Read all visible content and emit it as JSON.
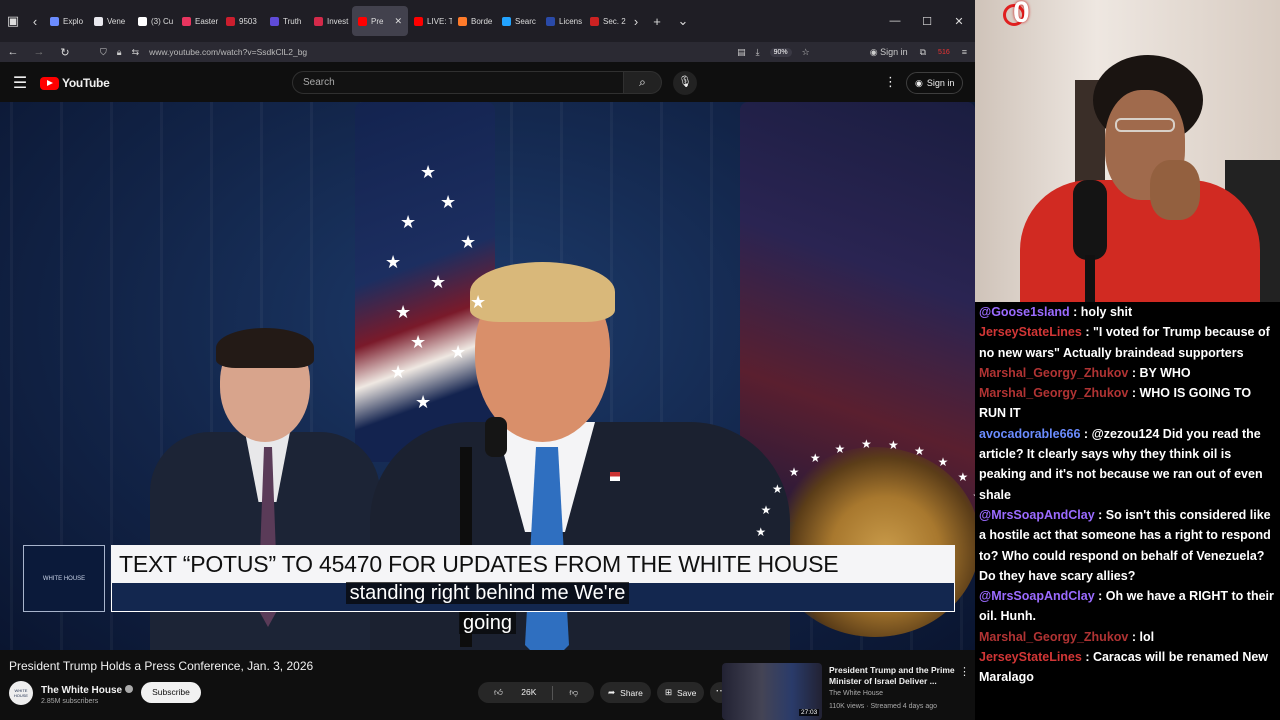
{
  "browser": {
    "tabs": [
      {
        "label": "Explo",
        "color": "#6b8cff",
        "active": false
      },
      {
        "label": "Vene",
        "color": "#e9e9ef",
        "active": false
      },
      {
        "label": "(3) Cu",
        "color": "#ffffff",
        "active": false
      },
      {
        "label": "Easter",
        "color": "#e8355f",
        "active": false
      },
      {
        "label": "9503",
        "color": "#cc1e2e",
        "active": false
      },
      {
        "label": "Truth",
        "color": "#5f4bd8",
        "active": false
      },
      {
        "label": "Invest",
        "color": "#d42a4a",
        "active": false
      },
      {
        "label": "Pre",
        "color": "#ff0000",
        "active": true
      },
      {
        "label": "LIVE: T",
        "color": "#ff0000",
        "active": false
      },
      {
        "label": "Borde",
        "color": "#ff7b2a",
        "active": false
      },
      {
        "label": "Searc",
        "color": "#22a3ff",
        "active": false
      },
      {
        "label": "Licens",
        "color": "#2a4aa8",
        "active": false
      },
      {
        "label": "Sec. 2",
        "color": "#c22",
        "active": false
      }
    ],
    "url": "www.youtube.com/watch?v=SsdkClL2_bg",
    "zoom": "90%",
    "sign_in": "Sign in",
    "badge_count": "516"
  },
  "youtube": {
    "logo_text": "YouTube",
    "search_placeholder": "Search",
    "sign_in": "Sign in",
    "video": {
      "banner_text": "TEXT “POTUS” TO 45470 FOR UPDATES FROM THE WHITE HOUSE",
      "logo_caption": "WHITE HOUSE",
      "caption_line1": "standing right behind me We're",
      "caption_line2": "going"
    },
    "title": "President Trump Holds a Press Conference, Jan. 3, 2026",
    "channel": {
      "name": "The White House",
      "subscribers": "2.85M subscribers",
      "avatar_text": "WHITE HOUSE",
      "subscribe_label": "Subscribe"
    },
    "actions": {
      "likes": "26K",
      "share": "Share",
      "save": "Save"
    },
    "recommended": {
      "title": "President Trump and the Prime Minister of Israel Deliver ...",
      "channel": "The White House",
      "meta": "110K views · Streamed 4 days ago",
      "duration": "27:03"
    }
  },
  "webcam": {
    "overlay_number": "0"
  },
  "chat": [
    {
      "user": "@Goose1sland",
      "text": "holy shit",
      "user_color": "#9b6bff"
    },
    {
      "user": "JerseyStateLines",
      "text": "\"I voted for Trump because of no new wars\" Actually braindead supporters",
      "user_color": "#d23636"
    },
    {
      "user": "Marshal_Georgy_Zhukov",
      "text": "BY WHO",
      "user_color": "#b03333"
    },
    {
      "user": "Marshal_Georgy_Zhukov",
      "text": "WHO IS GOING TO RUN IT",
      "user_color": "#b03333"
    },
    {
      "user": "avocadorable666",
      "text": "@zezou124 Did you read the article? It clearly says why they think oil is peaking and it's not because we ran out of even shale",
      "user_color": "#6b8cff"
    },
    {
      "user": "@MrsSoapAndClay",
      "text": "So isn't this considered like a hostile act that someone has a right to respond to? Who could respond on behalf of Venezuela? Do they have scary allies?",
      "user_color": "#9b6bff"
    },
    {
      "user": "@MrsSoapAndClay",
      "text": "Oh we have a RIGHT to their oil. Hunh.",
      "user_color": "#9b6bff"
    },
    {
      "user": "Marshal_Georgy_Zhukov",
      "text": "lol",
      "user_color": "#b03333"
    },
    {
      "user": "JerseyStateLines",
      "text": "Caracas will be renamed New Maralago",
      "user_color": "#d23636"
    }
  ]
}
